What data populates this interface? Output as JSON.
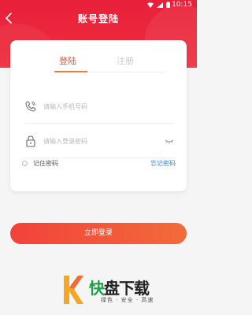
{
  "status_bar": {
    "time": "10:15"
  },
  "header": {
    "title": "账号登陆"
  },
  "tabs": {
    "login": "登陆",
    "register": "注册"
  },
  "form": {
    "phone_placeholder": "请输入手机号码",
    "password_placeholder": "请输入登录密码",
    "remember_label": "记住密码",
    "forgot_label": "忘记密码"
  },
  "login_button": {
    "label": "立即登录"
  },
  "watermark": {
    "brand_char": "快",
    "name_rest": "盘下载",
    "tagline": "绿色 · 安全 · 高速"
  },
  "colors": {
    "header": "#e8203a",
    "accent": "#f07a3a",
    "link": "#3a82d6"
  }
}
